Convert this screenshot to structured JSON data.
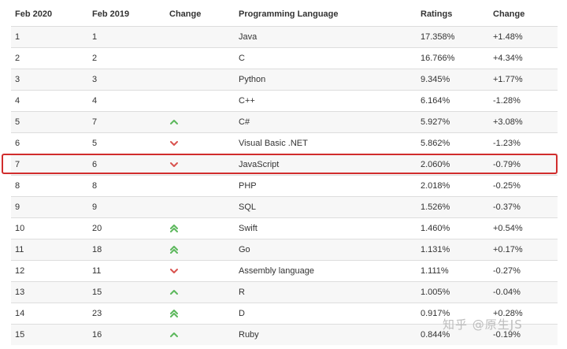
{
  "headers": {
    "feb2020": "Feb 2020",
    "feb2019": "Feb 2019",
    "change_arrow": "Change",
    "language": "Programming Language",
    "ratings": "Ratings",
    "change_pct": "Change"
  },
  "rows": [
    {
      "rank2020": "1",
      "rank2019": "1",
      "trend": "none",
      "language": "Java",
      "rating": "17.358%",
      "change": "+1.48%"
    },
    {
      "rank2020": "2",
      "rank2019": "2",
      "trend": "none",
      "language": "C",
      "rating": "16.766%",
      "change": "+4.34%"
    },
    {
      "rank2020": "3",
      "rank2019": "3",
      "trend": "none",
      "language": "Python",
      "rating": "9.345%",
      "change": "+1.77%"
    },
    {
      "rank2020": "4",
      "rank2019": "4",
      "trend": "none",
      "language": "C++",
      "rating": "6.164%",
      "change": "-1.28%"
    },
    {
      "rank2020": "5",
      "rank2019": "7",
      "trend": "up",
      "language": "C#",
      "rating": "5.927%",
      "change": "+3.08%"
    },
    {
      "rank2020": "6",
      "rank2019": "5",
      "trend": "down",
      "language": "Visual Basic .NET",
      "rating": "5.862%",
      "change": "-1.23%"
    },
    {
      "rank2020": "7",
      "rank2019": "6",
      "trend": "down",
      "language": "JavaScript",
      "rating": "2.060%",
      "change": "-0.79%"
    },
    {
      "rank2020": "8",
      "rank2019": "8",
      "trend": "none",
      "language": "PHP",
      "rating": "2.018%",
      "change": "-0.25%"
    },
    {
      "rank2020": "9",
      "rank2019": "9",
      "trend": "none",
      "language": "SQL",
      "rating": "1.526%",
      "change": "-0.37%"
    },
    {
      "rank2020": "10",
      "rank2019": "20",
      "trend": "double-up",
      "language": "Swift",
      "rating": "1.460%",
      "change": "+0.54%"
    },
    {
      "rank2020": "11",
      "rank2019": "18",
      "trend": "double-up",
      "language": "Go",
      "rating": "1.131%",
      "change": "+0.17%"
    },
    {
      "rank2020": "12",
      "rank2019": "11",
      "trend": "down",
      "language": "Assembly language",
      "rating": "1.111%",
      "change": "-0.27%"
    },
    {
      "rank2020": "13",
      "rank2019": "15",
      "trend": "up",
      "language": "R",
      "rating": "1.005%",
      "change": "-0.04%"
    },
    {
      "rank2020": "14",
      "rank2019": "23",
      "trend": "double-up",
      "language": "D",
      "rating": "0.917%",
      "change": "+0.28%"
    },
    {
      "rank2020": "15",
      "rank2019": "16",
      "trend": "up",
      "language": "Ruby",
      "rating": "0.844%",
      "change": "-0.19%"
    }
  ],
  "highlighted_language": "JavaScript",
  "colors": {
    "up": "#5cb85c",
    "down": "#d9534f",
    "highlight_border": "#d12d2d"
  },
  "watermark": "知乎 @原生JS"
}
